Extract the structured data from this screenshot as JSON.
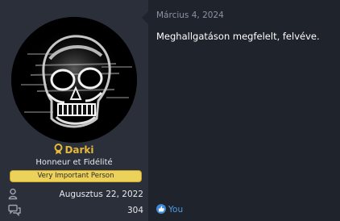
{
  "user": {
    "username": "Darki",
    "title": "Honneur et Fidélité",
    "banner": "Very Important Person",
    "joined": "Augusztus 22, 2022",
    "messages": "304"
  },
  "post": {
    "date": "Március 4, 2024",
    "body": "Meghallgatáson megfelelt, felvéve.",
    "reactions_text": "You"
  },
  "icons": {
    "username_badge": "award-ribbon-icon",
    "joined": "user-icon",
    "messages": "chat-bubbles-icon",
    "reaction": "like-icon"
  },
  "colors": {
    "sidebar_bg": "#2a2f39",
    "main_bg": "#1f232b",
    "username": "#e6b93a",
    "banner_bg": "#ecd15a",
    "date": "#8c93a3",
    "link": "#4a9ce0"
  }
}
